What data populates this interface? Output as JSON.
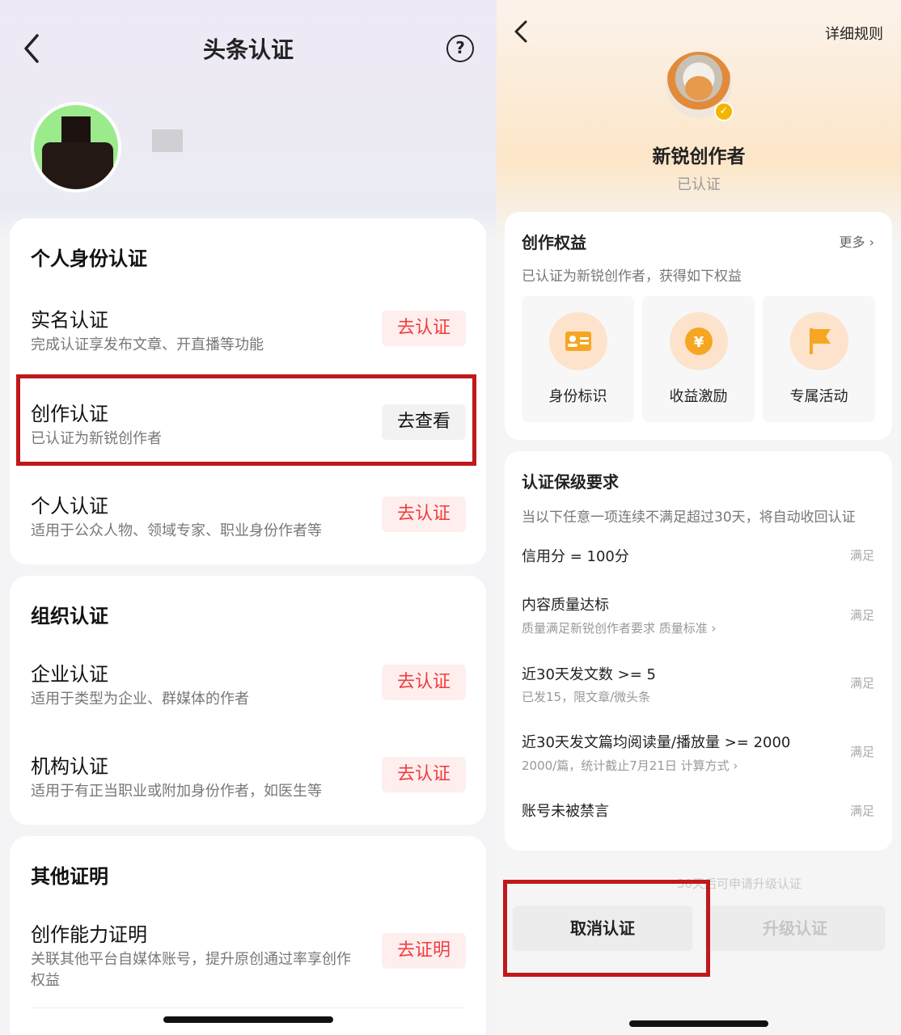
{
  "left": {
    "title": "头条认证",
    "help_symbol": "?",
    "personal": {
      "title": "个人身份认证",
      "items": [
        {
          "title": "实名认证",
          "desc": "完成认证享发布文章、开直播等功能",
          "button": "去认证"
        },
        {
          "title": "创作认证",
          "desc": "已认证为新锐创作者",
          "button": "去查看"
        },
        {
          "title": "个人认证",
          "desc": "适用于公众人物、领域专家、职业身份作者等",
          "button": "去认证"
        }
      ]
    },
    "org": {
      "title": "组织认证",
      "items": [
        {
          "title": "企业认证",
          "desc": "适用于类型为企业、群媒体的作者",
          "button": "去认证"
        },
        {
          "title": "机构认证",
          "desc": "适用于有正当职业或附加身份作者，如医生等",
          "button": "去认证"
        }
      ]
    },
    "other": {
      "title": "其他证明",
      "items": [
        {
          "title": "创作能力证明",
          "desc": "关联其他平台自媒体账号，提升原创通过率享创作权益",
          "button": "去证明"
        }
      ]
    }
  },
  "right": {
    "rules": "详细规则",
    "name": "新锐创作者",
    "status": "已认证",
    "benefits": {
      "title": "创作权益",
      "more": "更多 ›",
      "subtitle": "已认证为新锐创作者，获得如下权益",
      "items": [
        {
          "label": "身份标识",
          "icon": "id-card-icon"
        },
        {
          "label": "收益激励",
          "icon": "yuan-coin-icon"
        },
        {
          "label": "专属活动",
          "icon": "flag-icon"
        }
      ]
    },
    "requirements": {
      "title": "认证保级要求",
      "subtitle": "当以下任意一项连续不满足超过30天，将自动收回认证",
      "items": [
        {
          "title": "信用分 = 100分",
          "sub": "",
          "state": "满足"
        },
        {
          "title": "内容质量达标",
          "sub": "质量满足新锐创作者要求  质量标准 ›",
          "state": "满足"
        },
        {
          "title": "近30天发文数 >= 5",
          "sub": "已发15，限文章/微头条",
          "state": "满足"
        },
        {
          "title": "近30天发文篇均阅读量/播放量 >= 2000",
          "sub": "2000/篇，统计截止7月21日  计算方式 ›",
          "state": "满足"
        },
        {
          "title": "账号未被禁言",
          "sub": "",
          "state": "满足"
        }
      ]
    },
    "upgrade_note": "30天后可申请升级认证",
    "cancel_button": "取消认证",
    "upgrade_button": "升级认证"
  }
}
